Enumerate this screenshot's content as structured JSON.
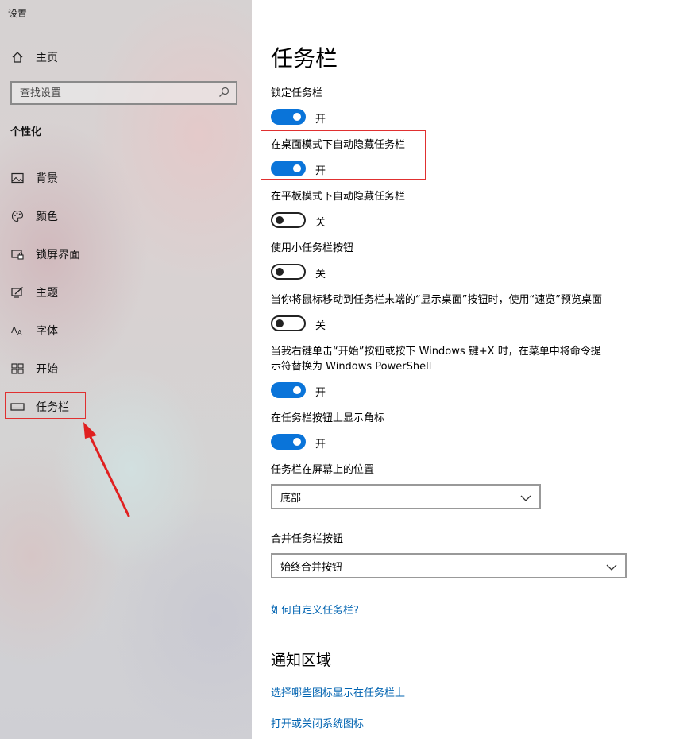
{
  "window": {
    "title": "设置"
  },
  "sidebar": {
    "home_label": "主页",
    "search_placeholder": "查找设置",
    "section_label": "个性化",
    "items": [
      {
        "label": "背景",
        "icon": "image-icon"
      },
      {
        "label": "颜色",
        "icon": "palette-icon"
      },
      {
        "label": "锁屏界面",
        "icon": "lock-screen-icon"
      },
      {
        "label": "主题",
        "icon": "theme-icon"
      },
      {
        "label": "字体",
        "icon": "font-icon"
      },
      {
        "label": "开始",
        "icon": "start-icon"
      },
      {
        "label": "任务栏",
        "icon": "taskbar-icon",
        "selected": true
      }
    ]
  },
  "main": {
    "title": "任务栏",
    "settings": [
      {
        "label": "锁定任务栏",
        "state": "开",
        "on": true
      },
      {
        "label": "在桌面模式下自动隐藏任务栏",
        "state": "开",
        "on": true
      },
      {
        "label": "在平板模式下自动隐藏任务栏",
        "state": "关",
        "on": false
      },
      {
        "label": "使用小任务栏按钮",
        "state": "关",
        "on": false
      },
      {
        "label": "当你将鼠标移动到任务栏末端的“显示桌面”按钮时，使用“速览”预览桌面",
        "state": "关",
        "on": false
      },
      {
        "label_line1": "当我右键单击“开始”按钮或按下 Windows 键+X 时，在菜单中将命令提",
        "label_line2": "示符替换为 Windows PowerShell",
        "state": "开",
        "on": true
      },
      {
        "label": "在任务栏按钮上显示角标",
        "state": "开",
        "on": true
      }
    ],
    "position": {
      "label": "任务栏在屏幕上的位置",
      "value": "底部"
    },
    "combine": {
      "label": "合并任务栏按钮",
      "value": "始终合并按钮"
    },
    "customize_link": "如何自定义任务栏?",
    "notification_section": {
      "title": "通知区域",
      "links": [
        "选择哪些图标显示在任务栏上",
        "打开或关闭系统图标"
      ]
    }
  },
  "colors": {
    "accent": "#0a74d9",
    "link": "#0063b1",
    "highlight": "#e03030"
  }
}
